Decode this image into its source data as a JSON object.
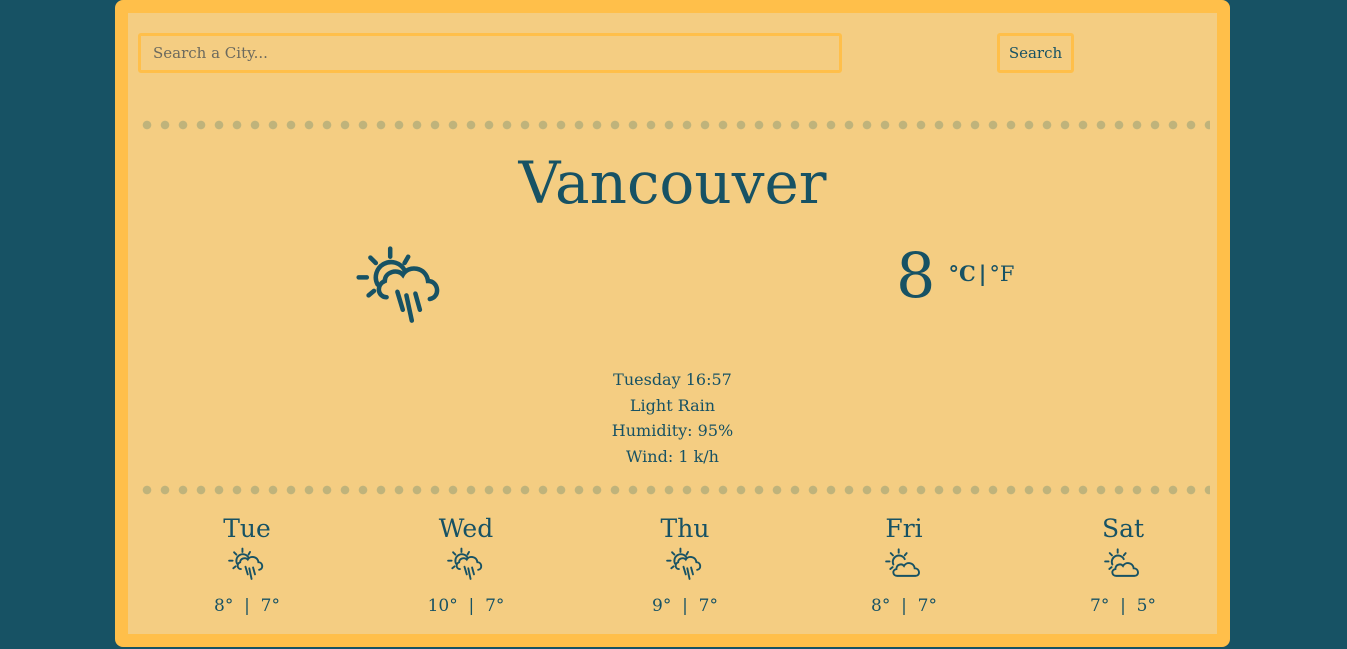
{
  "search": {
    "placeholder": "Search a City...",
    "button_label": "Search"
  },
  "current": {
    "city": "Vancouver",
    "icon": "sun-cloud-rain-icon",
    "temperature": "8",
    "unit_c": "°C",
    "unit_separator": "|",
    "unit_f": "°F",
    "datetime": "Tuesday 16:57",
    "description": "Light Rain",
    "humidity": "Humidity: 95%",
    "wind": "Wind: 1 k/h"
  },
  "forecast": [
    {
      "day": "Tue",
      "icon": "sun-cloud-rain-icon",
      "temps": "8°  |  7°"
    },
    {
      "day": "Wed",
      "icon": "sun-cloud-rain-icon",
      "temps": "10°  |  7°"
    },
    {
      "day": "Thu",
      "icon": "sun-cloud-rain-icon",
      "temps": "9°  |  7°"
    },
    {
      "day": "Fri",
      "icon": "partly-cloudy-icon",
      "temps": "8°  |  7°"
    },
    {
      "day": "Sat",
      "icon": "partly-cloudy-icon",
      "temps": "7°  |  5°"
    }
  ],
  "colors": {
    "background": "#175264",
    "frame": "#ffbf4a",
    "panel": "#f4cd82",
    "text": "#175264",
    "dots": "#bfb37b"
  }
}
